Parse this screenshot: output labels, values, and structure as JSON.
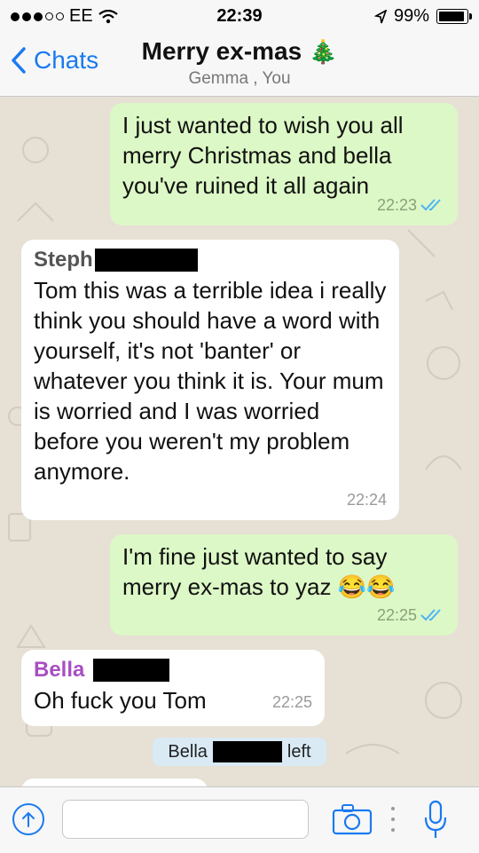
{
  "status_bar": {
    "carrier": "EE",
    "time": "22:39",
    "battery": "99%",
    "signal_bars": 3,
    "signal_total": 5
  },
  "header": {
    "back_label": "Chats",
    "title": "Merry ex-mas",
    "title_emoji": "🎄",
    "participants": "Gemma , You"
  },
  "messages": [
    {
      "direction": "outgoing",
      "text": "I just wanted to wish you all merry Christmas and bella you've ruined it all again",
      "time": "22:23",
      "status": "read"
    },
    {
      "direction": "incoming",
      "sender": "Steph",
      "sender_color": "#555555",
      "text": "Tom this was a terrible idea i really think you should have a word with yourself, it's not 'banter' or whatever you think it is. Your mum is worried and I was worried before you weren't my problem anymore.",
      "time": "22:24"
    },
    {
      "direction": "outgoing",
      "text": "I'm fine just wanted to say merry ex-mas to yaz 😂😂",
      "time": "22:25",
      "status": "read"
    },
    {
      "direction": "incoming",
      "sender": "Bella",
      "sender_color": "#a94fc2",
      "text": "Oh fuck you Tom",
      "time": "22:25"
    }
  ],
  "system_message": {
    "name": "Bella",
    "action": "left"
  },
  "input": {
    "placeholder": ""
  },
  "colors": {
    "accent": "#1a7af0",
    "outgoing_bubble": "#dcf8c6",
    "incoming_bubble": "#ffffff",
    "read_ticks": "#4fb3f6",
    "chat_background": "#e6e0d5"
  },
  "icons": [
    "signal-dots-icon",
    "wifi-icon",
    "location-arrow-icon",
    "battery-icon",
    "chevron-left-icon",
    "double-check-icon",
    "upload-arrow-icon",
    "camera-icon",
    "microphone-icon"
  ]
}
